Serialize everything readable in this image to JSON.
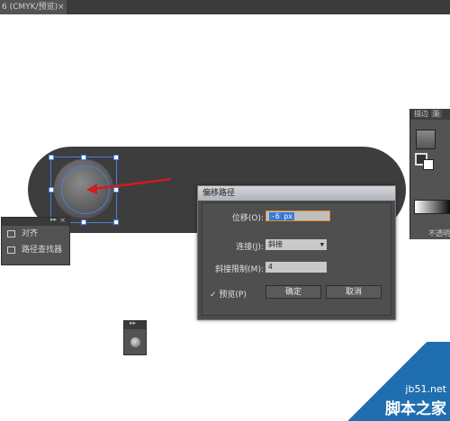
{
  "tab": {
    "title": "6 (CMYK/预览)",
    "close": "×"
  },
  "align_panel": {
    "items": [
      {
        "label": "对齐",
        "icon": "align-icon"
      },
      {
        "label": "路径查找器",
        "icon": "pathfinder-icon"
      }
    ]
  },
  "dialog": {
    "title": "偏移路径",
    "offset_label": "位移(O):",
    "offset_value": "-6 px",
    "join_label": "连接(J):",
    "join_value": "斜接",
    "miter_label": "斜接限制(M):",
    "miter_value": "4",
    "preview_label": "预览(P)",
    "preview_check": "✓",
    "ok_label": "确定",
    "cancel_label": "取消"
  },
  "right_panel": {
    "tab1": "描边",
    "tab2": "渐",
    "opacity_label": "不透明"
  },
  "watermark": {
    "site": "jb51.net",
    "name": "脚本之家"
  },
  "colors": {
    "accent": "#4a7fd8",
    "arrow": "#d01c1c",
    "panel_bg": "#535353",
    "pill_bg": "#3d3d3d"
  }
}
